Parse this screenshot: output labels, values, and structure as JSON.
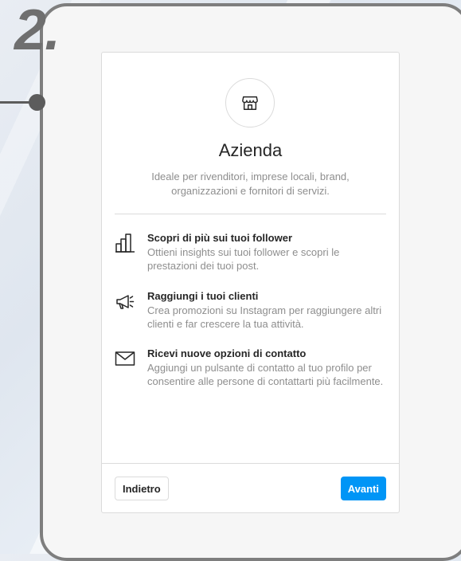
{
  "step": {
    "number": "2."
  },
  "card": {
    "icon": "storefront-icon",
    "title": "Azienda",
    "subtitle": "Ideale per rivenditori, imprese locali, brand, organizzazioni e fornitori di servizi."
  },
  "features": [
    {
      "icon": "bar-chart-icon",
      "title": "Scopri di più sui tuoi follower",
      "description": "Ottieni insights sui tuoi follower e scopri le prestazioni dei tuoi post."
    },
    {
      "icon": "megaphone-icon",
      "title": "Raggiungi i tuoi clienti",
      "description": "Crea promozioni su Instagram per raggiungere altri clienti e far crescere la tua attività."
    },
    {
      "icon": "envelope-icon",
      "title": "Ricevi nuove opzioni di contatto",
      "description": "Aggiungi un pulsante di contatto al tuo profilo per consentire alle persone di contattarti più facilmente."
    }
  ],
  "footer": {
    "back_label": "Indietro",
    "next_label": "Avanti"
  },
  "colors": {
    "accent": "#0095f6",
    "text_primary": "#262626",
    "text_secondary": "#8e8e8e",
    "border": "#dbdbdb"
  }
}
